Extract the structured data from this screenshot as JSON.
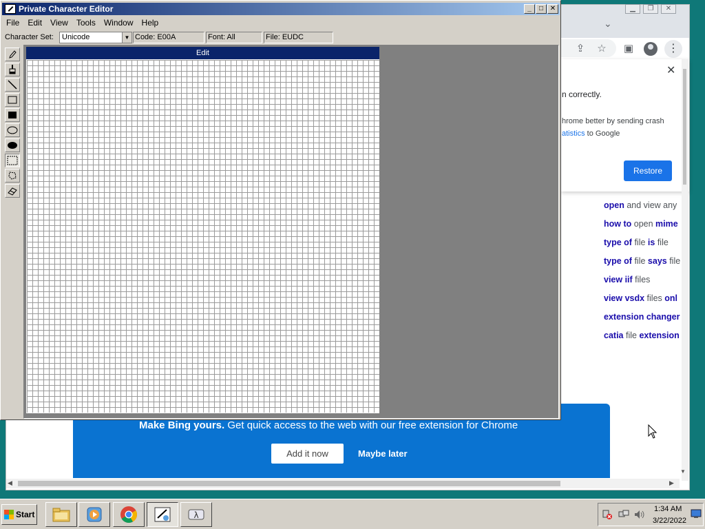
{
  "chrome": {
    "crash_title": "n correctly.",
    "crash_line1": "hrome better by sending crash",
    "crash_line2_link": "atistics",
    "crash_line2_rest": " to Google",
    "restore_label": "Restore",
    "close_glyph": "✕",
    "related": [
      {
        "a": "open",
        "b": " and view any"
      },
      {
        "a": "how to",
        "b": " open ",
        "c": "mime"
      },
      {
        "a": "type of",
        "b": " file ",
        "c": "is",
        "d": " file"
      },
      {
        "a": "type of",
        "b": " file ",
        "c": "says",
        "d": " file"
      },
      {
        "a": "view iif",
        "b": " files"
      },
      {
        "a": "view vsdx",
        "b": " files ",
        "c": "onl"
      },
      {
        "a": "extension changer",
        "b": ""
      },
      {
        "a": "catia",
        "b": " file ",
        "c": "extension"
      }
    ],
    "bing": {
      "bold": "Make Bing yours.",
      "text": " Get quick access to the web with our free extension for Chrome",
      "add_label": "Add it now",
      "later_label": "Maybe later"
    }
  },
  "pce": {
    "title": "Private Character Editor",
    "menu": [
      "File",
      "Edit",
      "View",
      "Tools",
      "Window",
      "Help"
    ],
    "charset_label": "Character Set:",
    "charset_value": "Unicode",
    "code": "Code: E00A",
    "font": "Font: All",
    "file": "File: EUDC",
    "edit_title": "Edit",
    "tools": [
      "pencil",
      "brush",
      "line",
      "hollow-rectangle",
      "filled-rectangle",
      "hollow-ellipse",
      "filled-ellipse",
      "rectangular-selection",
      "freeform-selection",
      "eraser"
    ],
    "active_tool": "rectangular-selection"
  },
  "taskbar": {
    "start_label": "Start",
    "time": "1:34 AM",
    "date": "3/22/2022"
  }
}
